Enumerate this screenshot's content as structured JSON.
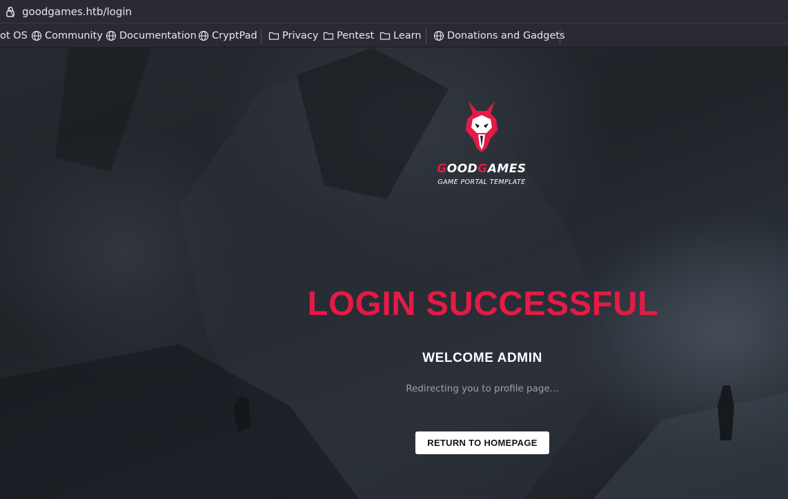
{
  "browser": {
    "url": "goodgames.htb/login"
  },
  "bookmarks": [
    {
      "label": "ot OS",
      "icon": "none"
    },
    {
      "label": "Community",
      "icon": "globe-icon"
    },
    {
      "label": "Documentation",
      "icon": "globe-icon"
    },
    {
      "label": "CryptPad",
      "icon": "globe-icon"
    },
    {
      "label": "Privacy",
      "icon": "folder-icon"
    },
    {
      "label": "Pentest",
      "icon": "folder-icon"
    },
    {
      "label": "Learn",
      "icon": "folder-icon"
    },
    {
      "label": "Donations and Gadgets",
      "icon": "globe-icon"
    }
  ],
  "page": {
    "brand_part1_red": "G",
    "brand_part2": "OOD",
    "brand_part3_red": "G",
    "brand_part4": "AMES",
    "tagline": "GAME PORTAL TEMPLATE",
    "headline": "LOGIN SUCCESSFUL",
    "welcome": "WELCOME ADMIN",
    "redirect": "Redirecting you to profile page...",
    "return_button": "RETURN TO HOMEPAGE"
  },
  "colors": {
    "accent": "#e31b46",
    "chrome": "#2b2a33",
    "background": "#1f2328"
  }
}
